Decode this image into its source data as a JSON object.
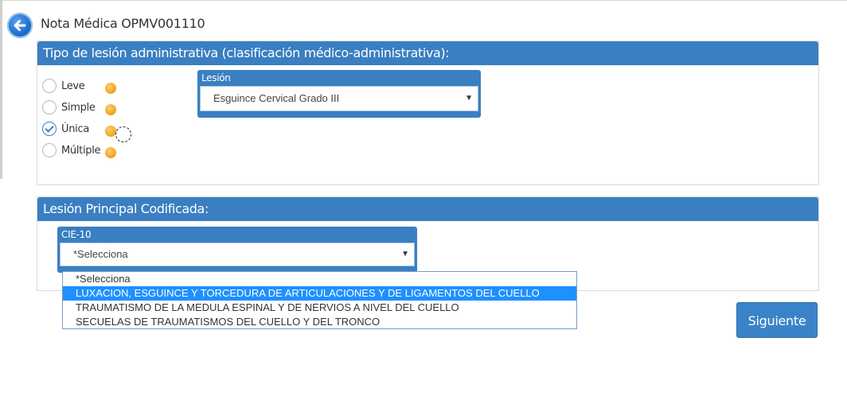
{
  "header": {
    "title": "Nota Médica OPMV001110"
  },
  "panel_tipo": {
    "title": "Tipo de lesión administrativa (clasificación médico-administrativa):",
    "options": [
      {
        "label": "Leve",
        "checked": false
      },
      {
        "label": "Simple",
        "checked": false
      },
      {
        "label": "Única",
        "checked": true
      },
      {
        "label": "Múltiple",
        "checked": false
      }
    ],
    "lesion_field": {
      "label": "Lesión",
      "value": "Esguince Cervical Grado III"
    }
  },
  "panel_principal": {
    "title": "Lesión Principal Codificada:",
    "cie_field": {
      "label": "CIE-10",
      "value": "*Selecciona"
    },
    "dropdown_options": [
      {
        "label": "*Selecciona",
        "highlighted": false
      },
      {
        "label": "LUXACION, ESGUINCE Y TORCEDURA DE ARTICULACIONES Y DE LIGAMENTOS DEL CUELLO",
        "highlighted": true
      },
      {
        "label": "TRAUMATISMO DE LA MEDULA ESPINAL Y DE NERVIOS A NIVEL DEL CUELLO",
        "highlighted": false
      },
      {
        "label": "SECUELAS DE TRAUMATISMOS DEL CUELLO Y DEL TRONCO",
        "highlighted": false
      }
    ]
  },
  "footer": {
    "next_label": "Siguiente"
  },
  "icons": {
    "back": "back-arrow-icon",
    "info": "info-icon",
    "dropdown": "chevron-down-icon"
  },
  "colors": {
    "accent": "#3a7fc1",
    "highlight": "#1e90ff",
    "info": "#f0a11e"
  }
}
